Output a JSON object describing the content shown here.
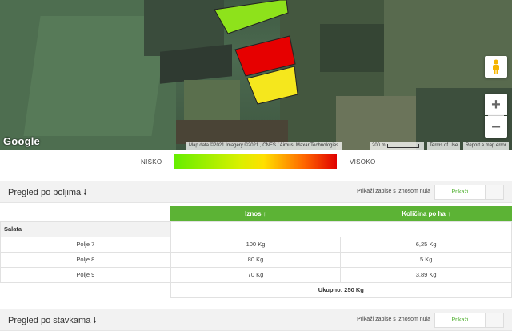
{
  "map": {
    "attribution": "Map data ©2021 Imagery ©2021 , CNES / Airbus, Maxar Technologies",
    "scale_label": "200 m",
    "terms_label": "Terms of Use",
    "report_label": "Report a map error",
    "logo_text": "Google",
    "zoom_in": "+",
    "zoom_out": "−",
    "field_colors": [
      "#8ee21b",
      "#e60000",
      "#f5e71d"
    ]
  },
  "legend": {
    "low_label": "NISKO",
    "high_label": "VISOKO"
  },
  "section1": {
    "title": "Pregled po poljima",
    "arrow": "🠗",
    "hint": "Prikaži zapise s iznosom nula",
    "toggle_label": "Prikaži"
  },
  "table": {
    "headers": [
      "Iznos ↑",
      "Količina po ha ↑"
    ],
    "group": "Salata",
    "rows": [
      {
        "name": "Polje 7",
        "amount": "100 Kg",
        "per_ha": "6,25 Kg"
      },
      {
        "name": "Polje 8",
        "amount": "80 Kg",
        "per_ha": "5 Kg"
      },
      {
        "name": "Polje 9",
        "amount": "70 Kg",
        "per_ha": "3,89 Kg"
      }
    ],
    "total": "Ukupno: 250 Kg"
  },
  "section2": {
    "title": "Pregled po stavkama",
    "arrow": "🠗",
    "hint": "Prikaži zapise s iznosom nula",
    "toggle_label": "Prikaži"
  },
  "colors": {
    "accent_green": "#5cb335",
    "legend_low": "#66ee00",
    "legend_high": "#e00000"
  }
}
